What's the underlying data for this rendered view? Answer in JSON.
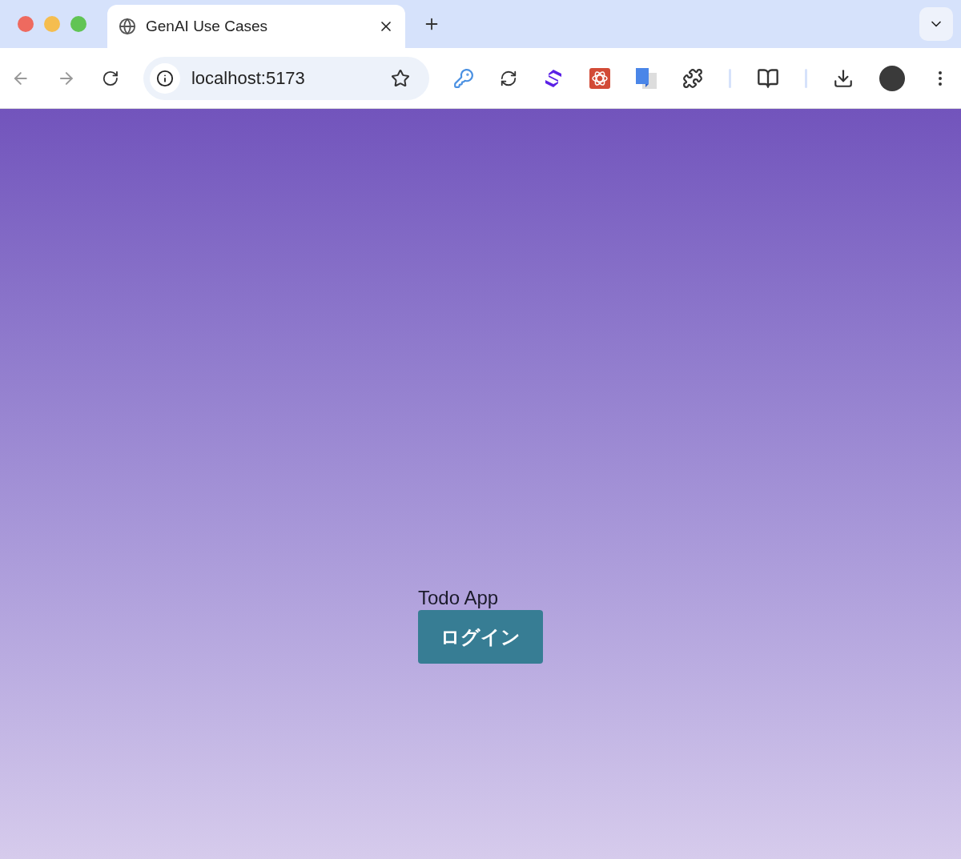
{
  "tabs": [
    {
      "title": "GenAI Use Cases",
      "selected": true
    }
  ],
  "address_bar": {
    "url": "localhost:5173"
  },
  "page": {
    "title": "Todo App",
    "login_button": "ログイン"
  }
}
